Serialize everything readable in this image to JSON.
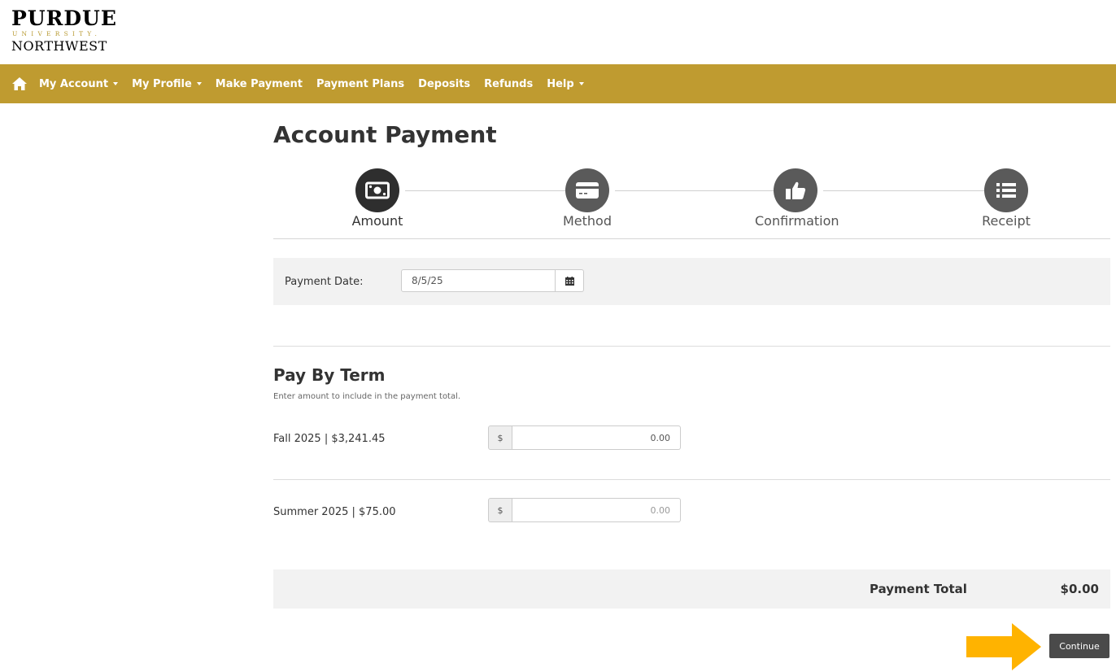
{
  "logo": {
    "line1": "PURDUE",
    "line2": "UNIVERSITY.",
    "line3": "NORTHWEST"
  },
  "nav": {
    "home_icon": "home-icon",
    "items": [
      {
        "label": "My Account",
        "dropdown": true
      },
      {
        "label": "My Profile",
        "dropdown": true
      },
      {
        "label": "Make Payment",
        "dropdown": false
      },
      {
        "label": "Payment Plans",
        "dropdown": false
      },
      {
        "label": "Deposits",
        "dropdown": false
      },
      {
        "label": "Refunds",
        "dropdown": false
      },
      {
        "label": "Help",
        "dropdown": true
      }
    ]
  },
  "page": {
    "title": "Account Payment"
  },
  "steps": [
    {
      "label": "Amount",
      "icon": "money-icon",
      "active": true
    },
    {
      "label": "Method",
      "icon": "credit-card-icon",
      "active": false
    },
    {
      "label": "Confirmation",
      "icon": "thumbs-up-icon",
      "active": false
    },
    {
      "label": "Receipt",
      "icon": "list-icon",
      "active": false
    }
  ],
  "payment_date": {
    "label": "Payment Date:",
    "value": "8/5/25",
    "icon": "calendar-icon"
  },
  "pay_by_term": {
    "title": "Pay By Term",
    "subtitle": "Enter amount to include in the payment total.",
    "terms": [
      {
        "label": "Fall 2025 | $3,241.45",
        "currency": "$",
        "amount": "0.00"
      },
      {
        "label": "Summer 2025 | $75.00",
        "currency": "$",
        "amount": "0.00"
      }
    ]
  },
  "total": {
    "label": "Payment Total",
    "value": "$0.00"
  },
  "actions": {
    "continue_label": "Continue"
  },
  "colors": {
    "brand_gold": "#bf9b30",
    "arrow": "#ffb300",
    "button": "#4a4a4a"
  }
}
